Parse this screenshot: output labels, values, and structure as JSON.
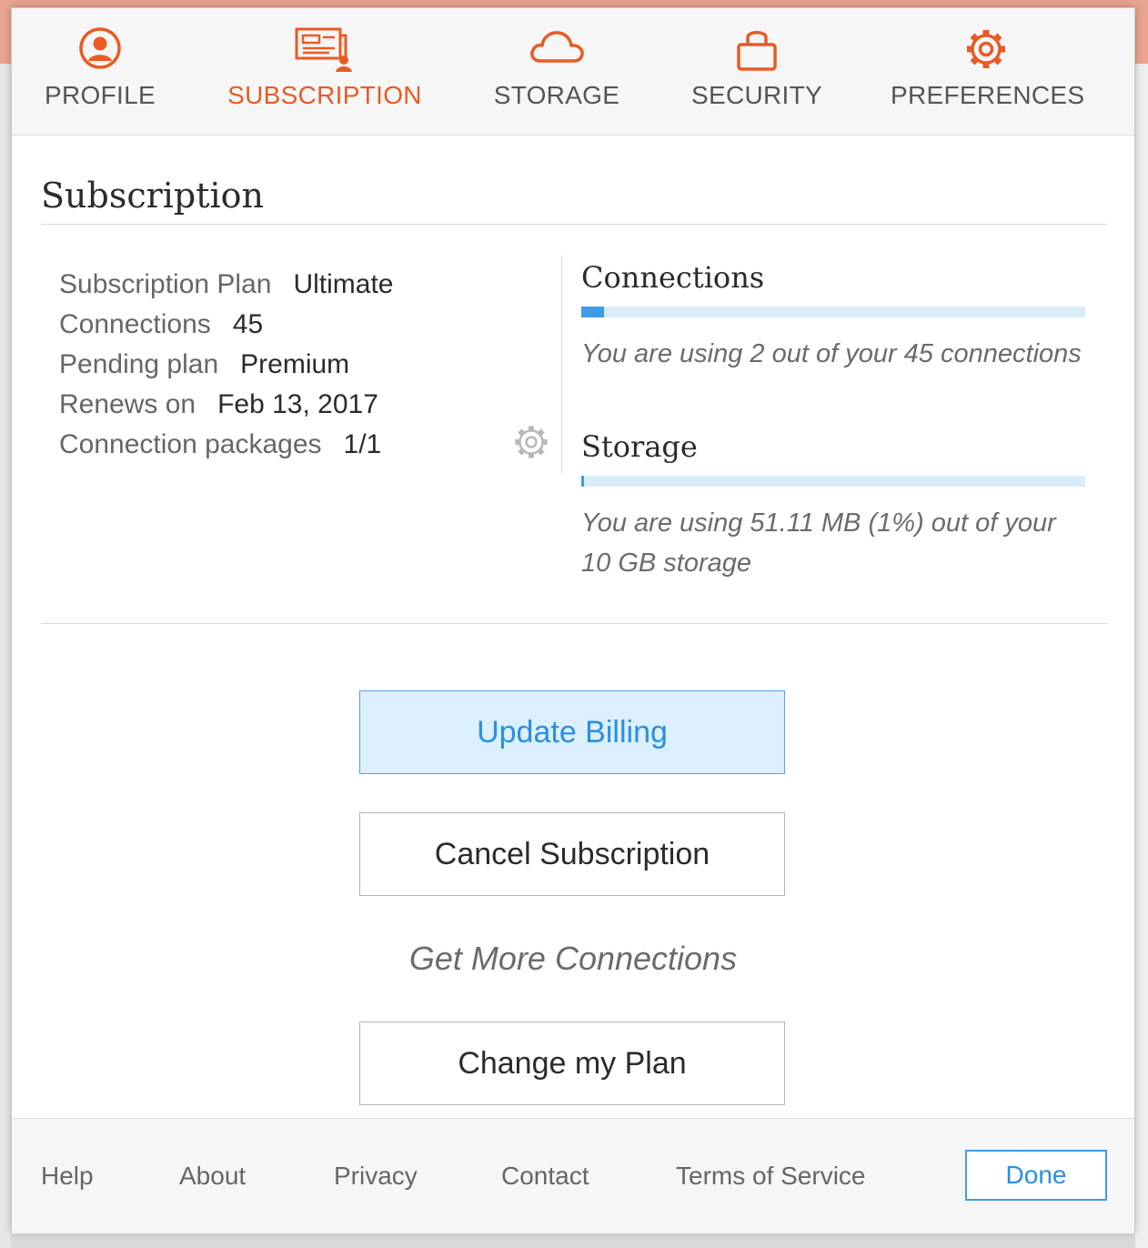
{
  "tabs": [
    {
      "label": "PROFILE",
      "icon": "user-circle-icon"
    },
    {
      "label": "SUBSCRIPTION",
      "icon": "subscription-card-icon",
      "active": true
    },
    {
      "label": "STORAGE",
      "icon": "cloud-icon"
    },
    {
      "label": "SECURITY",
      "icon": "lock-icon"
    },
    {
      "label": "PREFERENCES",
      "icon": "gear-icon"
    }
  ],
  "page_title": "Subscription",
  "details": [
    {
      "key": "Subscription Plan",
      "value": "Ultimate"
    },
    {
      "key": "Connections",
      "value": "45"
    },
    {
      "key": "Pending plan",
      "value": "Premium"
    },
    {
      "key": "Renews on",
      "value": "Feb 13, 2017"
    },
    {
      "key": "Connection packages",
      "value": "1/1"
    }
  ],
  "usage": {
    "connections": {
      "title": "Connections",
      "used": 2,
      "total": 45,
      "text": "You are using 2 out of your 45 connections"
    },
    "storage": {
      "title": "Storage",
      "percent": 1,
      "text": "You are using 51.11 MB (1%) out of your 10 GB storage"
    }
  },
  "buttons": {
    "update_billing": "Update Billing",
    "cancel_subscription": "Cancel Subscription",
    "get_more_connections": "Get More Connections",
    "change_plan": "Change my Plan"
  },
  "footer": {
    "links": [
      "Help",
      "About",
      "Privacy",
      "Contact",
      "Terms of Service"
    ],
    "done": "Done"
  },
  "colors": {
    "accent_orange": "#e85b25",
    "accent_blue": "#3f9be6",
    "bar_track": "#d9ecf9"
  }
}
